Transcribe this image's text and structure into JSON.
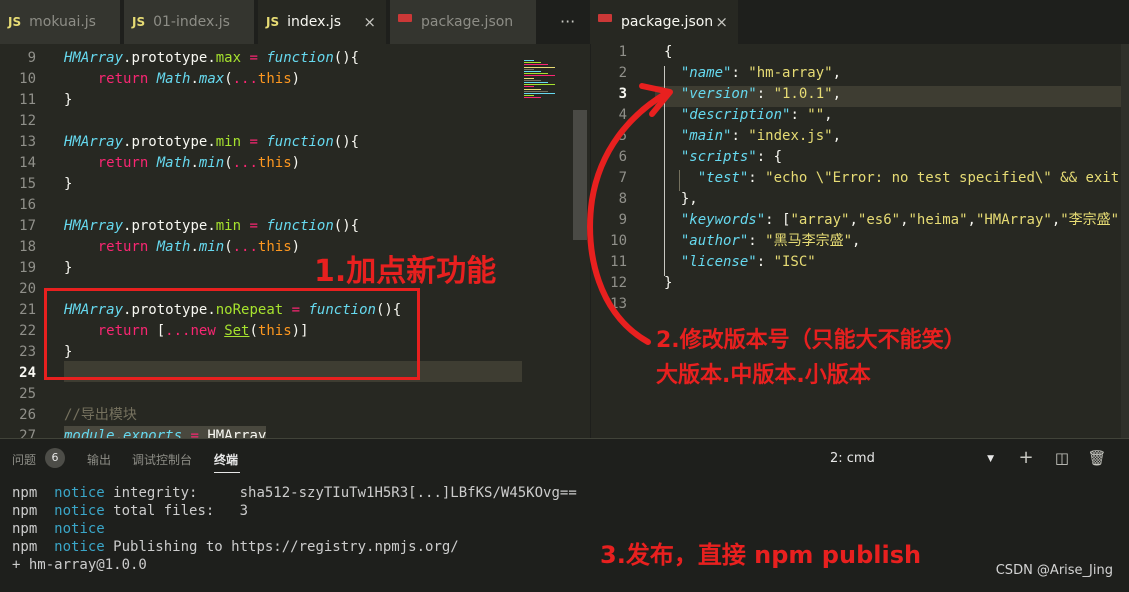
{
  "left_tabs": [
    {
      "icon": "JS",
      "label": "mokuai.js"
    },
    {
      "icon": "JS",
      "label": "01-index.js"
    },
    {
      "icon": "JS",
      "label": "index.js",
      "close": "×"
    },
    {
      "icon": "json-icon",
      "label": "package.json"
    }
  ],
  "left_more": "···",
  "right_tab": {
    "label": "package.json",
    "close": "×"
  },
  "left_editor": {
    "lines": [
      {
        "n": "9",
        "parts": [
          [
            "cls",
            "HMArray"
          ],
          [
            "",
            "."
          ],
          [
            "",
            "prototype"
          ],
          [
            "",
            "."
          ],
          [
            "prop",
            "max"
          ],
          [
            "",
            " "
          ],
          [
            "op",
            "="
          ],
          [
            "",
            " "
          ],
          [
            "fn",
            "function"
          ],
          [
            "",
            "(){"
          ]
        ]
      },
      {
        "n": "10",
        "parts": [
          [
            "",
            "    "
          ],
          [
            "kw",
            "return"
          ],
          [
            "",
            " "
          ],
          [
            "cls2",
            "Math"
          ],
          [
            "",
            "."
          ],
          [
            "cls2",
            "max"
          ],
          [
            "",
            "("
          ],
          [
            "op",
            "..."
          ],
          [
            "this",
            "this"
          ],
          [
            "",
            ")"
          ]
        ]
      },
      {
        "n": "11",
        "parts": [
          [
            "",
            "}"
          ]
        ]
      },
      {
        "n": "12",
        "parts": []
      },
      {
        "n": "13",
        "parts": [
          [
            "cls",
            "HMArray"
          ],
          [
            "",
            "."
          ],
          [
            "",
            "prototype"
          ],
          [
            "",
            "."
          ],
          [
            "prop",
            "min"
          ],
          [
            "",
            " "
          ],
          [
            "op",
            "="
          ],
          [
            "",
            " "
          ],
          [
            "fn",
            "function"
          ],
          [
            "",
            "(){"
          ]
        ]
      },
      {
        "n": "14",
        "parts": [
          [
            "",
            "    "
          ],
          [
            "kw",
            "return"
          ],
          [
            "",
            " "
          ],
          [
            "cls2",
            "Math"
          ],
          [
            "",
            "."
          ],
          [
            "cls2",
            "min"
          ],
          [
            "",
            "("
          ],
          [
            "op",
            "..."
          ],
          [
            "this",
            "this"
          ],
          [
            "",
            ")"
          ]
        ]
      },
      {
        "n": "15",
        "parts": [
          [
            "",
            "}"
          ]
        ]
      },
      {
        "n": "16",
        "parts": []
      },
      {
        "n": "17",
        "parts": [
          [
            "cls",
            "HMArray"
          ],
          [
            "",
            "."
          ],
          [
            "",
            "prototype"
          ],
          [
            "",
            "."
          ],
          [
            "prop",
            "min"
          ],
          [
            "",
            " "
          ],
          [
            "op",
            "="
          ],
          [
            "",
            " "
          ],
          [
            "fn",
            "function"
          ],
          [
            "",
            "(){"
          ]
        ]
      },
      {
        "n": "18",
        "parts": [
          [
            "",
            "    "
          ],
          [
            "kw",
            "return"
          ],
          [
            "",
            " "
          ],
          [
            "cls2",
            "Math"
          ],
          [
            "",
            "."
          ],
          [
            "cls2",
            "min"
          ],
          [
            "",
            "("
          ],
          [
            "op",
            "..."
          ],
          [
            "this",
            "this"
          ],
          [
            "",
            ")"
          ]
        ]
      },
      {
        "n": "19",
        "parts": [
          [
            "",
            "}"
          ]
        ]
      },
      {
        "n": "20",
        "parts": []
      },
      {
        "n": "21",
        "parts": [
          [
            "cls",
            "HMArray"
          ],
          [
            "",
            "."
          ],
          [
            "",
            "prototype"
          ],
          [
            "",
            "."
          ],
          [
            "prop",
            "noRepeat"
          ],
          [
            "",
            " "
          ],
          [
            "op",
            "="
          ],
          [
            "",
            " "
          ],
          [
            "fn",
            "function"
          ],
          [
            "",
            "(){"
          ]
        ]
      },
      {
        "n": "22",
        "parts": [
          [
            "",
            "    "
          ],
          [
            "kw",
            "return"
          ],
          [
            "",
            " "
          ],
          [
            "",
            "["
          ],
          [
            "op",
            "..."
          ],
          [
            "kw",
            "new"
          ],
          [
            "",
            " "
          ],
          [
            "green",
            "Set"
          ],
          [
            "",
            "("
          ],
          [
            "this",
            "this"
          ],
          [
            "",
            ")]"
          ]
        ]
      },
      {
        "n": "23",
        "parts": [
          [
            "",
            "}"
          ]
        ]
      },
      {
        "n": "24",
        "parts": []
      },
      {
        "n": "25",
        "parts": []
      },
      {
        "n": "26",
        "parts": [
          [
            "cm",
            "//导出模块"
          ]
        ]
      },
      {
        "n": "27",
        "parts": [
          [
            "cls",
            "module"
          ],
          [
            "",
            "."
          ],
          [
            "cls",
            "exports"
          ],
          [
            "",
            " "
          ],
          [
            "op",
            "="
          ],
          [
            "",
            " "
          ],
          [
            "",
            "HMArray"
          ]
        ]
      }
    ],
    "partial_top": "//...(){ ..."
  },
  "right_editor": {
    "lines": [
      {
        "n": "1",
        "parts": [
          [
            "",
            "{"
          ]
        ]
      },
      {
        "n": "2",
        "parts": [
          [
            "",
            "  "
          ],
          [
            "jkey",
            "\"name\""
          ],
          [
            "",
            ": "
          ],
          [
            "str",
            "\"hm-array\""
          ],
          [
            "",
            ","
          ]
        ]
      },
      {
        "n": "3",
        "parts": [
          [
            "",
            "  "
          ],
          [
            "jkey",
            "\"version\""
          ],
          [
            "",
            ": "
          ],
          [
            "str",
            "\"1.0.1\""
          ],
          [
            "",
            ","
          ]
        ]
      },
      {
        "n": "4",
        "parts": [
          [
            "",
            "  "
          ],
          [
            "jkey",
            "\"description\""
          ],
          [
            "",
            ": "
          ],
          [
            "str",
            "\"\""
          ],
          [
            "",
            ","
          ]
        ]
      },
      {
        "n": "5",
        "parts": [
          [
            "",
            "  "
          ],
          [
            "jkey",
            "\"main\""
          ],
          [
            "",
            ": "
          ],
          [
            "str",
            "\"index.js\""
          ],
          [
            "",
            ","
          ]
        ]
      },
      {
        "n": "6",
        "parts": [
          [
            "",
            "  "
          ],
          [
            "jkey",
            "\"scripts\""
          ],
          [
            "",
            ": {"
          ]
        ]
      },
      {
        "n": "7",
        "parts": [
          [
            "",
            "    "
          ],
          [
            "jkey",
            "\"test\""
          ],
          [
            "",
            ": "
          ],
          [
            "str",
            "\"echo \\\"Error: no test specified\\\" && exit"
          ]
        ]
      },
      {
        "n": "8",
        "parts": [
          [
            "",
            "  },"
          ]
        ]
      },
      {
        "n": "9",
        "parts": [
          [
            "",
            "  "
          ],
          [
            "jkey",
            "\"keywords\""
          ],
          [
            "",
            ": ["
          ],
          [
            "str",
            "\"array\""
          ],
          [
            "",
            ","
          ],
          [
            "str",
            "\"es6\""
          ],
          [
            "",
            ","
          ],
          [
            "str",
            "\"heima\""
          ],
          [
            "",
            ","
          ],
          [
            "str",
            "\"HMArray\""
          ],
          [
            "",
            ","
          ],
          [
            "str",
            "\"李宗盛\""
          ]
        ]
      },
      {
        "n": "10",
        "parts": [
          [
            "",
            "  "
          ],
          [
            "jkey",
            "\"author\""
          ],
          [
            "",
            ": "
          ],
          [
            "str",
            "\"黑马李宗盛\""
          ],
          [
            "",
            ","
          ]
        ]
      },
      {
        "n": "11",
        "parts": [
          [
            "",
            "  "
          ],
          [
            "jkey",
            "\"license\""
          ],
          [
            "",
            ": "
          ],
          [
            "str",
            "\"ISC\""
          ]
        ]
      },
      {
        "n": "12",
        "parts": [
          [
            "",
            "}"
          ]
        ]
      },
      {
        "n": "13",
        "parts": []
      }
    ]
  },
  "annotations": {
    "step1": "1.加点新功能",
    "step2_line1": "2.修改版本号（只能大不能笑）",
    "step2_line2": "大版本.中版本.小版本",
    "step3": "3.发布，直接 npm publish"
  },
  "panel": {
    "tabs": [
      "问题",
      "输出",
      "调试控制台",
      "终端"
    ],
    "problems_count": "6",
    "terminal_select": "2: cmd",
    "terminal_lines": [
      {
        "prefix": "npm",
        "notice": "notice",
        "text": " integrity:     sha512-szyTIuTw1H5R3[...]LBfKS/W45KOvg=="
      },
      {
        "prefix": "npm",
        "notice": "notice",
        "text": " total files:   3"
      },
      {
        "prefix": "npm",
        "notice": "notice",
        "text": ""
      },
      {
        "prefix": "npm",
        "notice": "notice",
        "text": " Publishing to https://registry.npmjs.org/"
      },
      {
        "prefix": "",
        "notice": "",
        "text": "+ hm-array@1.0.0"
      }
    ]
  },
  "watermark": "CSDN @Arise_Jing",
  "colors": {
    "annotation_red": "#e8201f",
    "editor_bg": "#272822",
    "keyword": "#f92672",
    "type": "#66d9ef",
    "string": "#e6db74"
  }
}
